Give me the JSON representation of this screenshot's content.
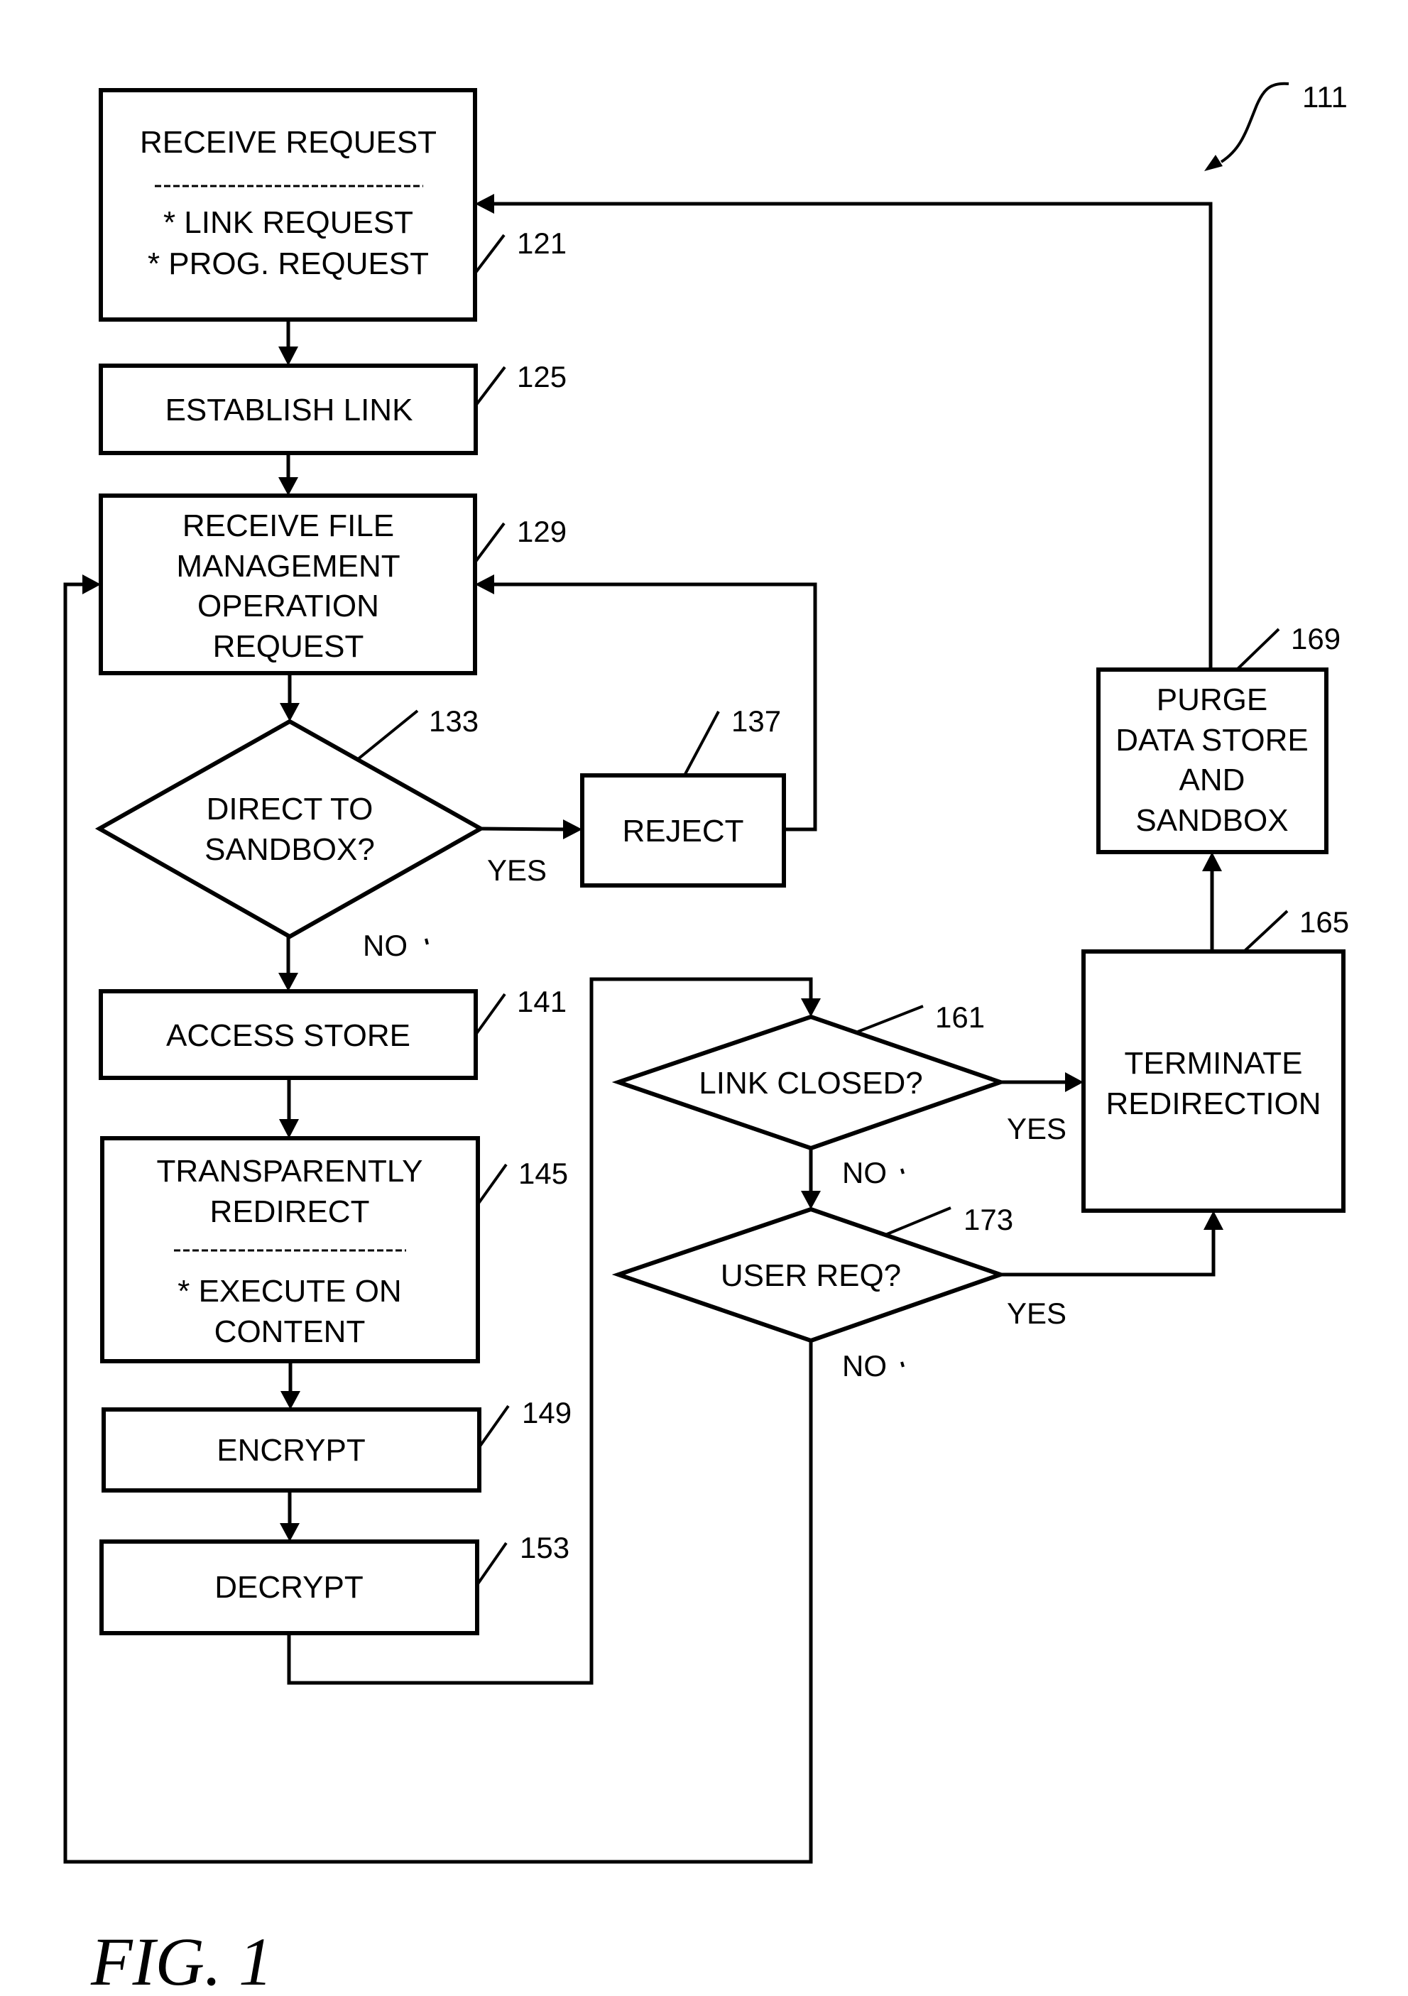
{
  "figure": {
    "label": "FIG. 1",
    "reference": "111"
  },
  "steps": {
    "s121": {
      "ref": "121",
      "title": "RECEIVE REQUEST",
      "items": [
        "* LINK REQUEST",
        "* PROG. REQUEST"
      ]
    },
    "s125": {
      "ref": "125",
      "lines": [
        "ESTABLISH LINK"
      ]
    },
    "s129": {
      "ref": "129",
      "lines": [
        "RECEIVE FILE",
        "MANAGEMENT",
        "OPERATION",
        "REQUEST"
      ]
    },
    "s133": {
      "ref": "133",
      "lines": [
        "DIRECT TO",
        "SANDBOX?"
      ],
      "yes": "YES",
      "no": "NO"
    },
    "s137": {
      "ref": "137",
      "lines": [
        "REJECT"
      ]
    },
    "s141": {
      "ref": "141",
      "lines": [
        "ACCESS STORE"
      ]
    },
    "s145": {
      "ref": "145",
      "lines": [
        "TRANSPARENTLY",
        "REDIRECT"
      ],
      "items": [
        "* EXECUTE ON",
        "CONTENT"
      ]
    },
    "s149": {
      "ref": "149",
      "lines": [
        "ENCRYPT"
      ]
    },
    "s153": {
      "ref": "153",
      "lines": [
        "DECRYPT"
      ]
    },
    "s161": {
      "ref": "161",
      "lines": [
        "LINK CLOSED?"
      ],
      "yes": "YES",
      "no": "NO"
    },
    "s165": {
      "ref": "165",
      "lines": [
        "TERMINATE",
        "REDIRECTION"
      ]
    },
    "s169": {
      "ref": "169",
      "lines": [
        "PURGE",
        "DATA STORE",
        "AND",
        "SANDBOX"
      ]
    },
    "s173": {
      "ref": "173",
      "lines": [
        "USER REQ?"
      ],
      "yes": "YES",
      "no": "NO"
    }
  }
}
